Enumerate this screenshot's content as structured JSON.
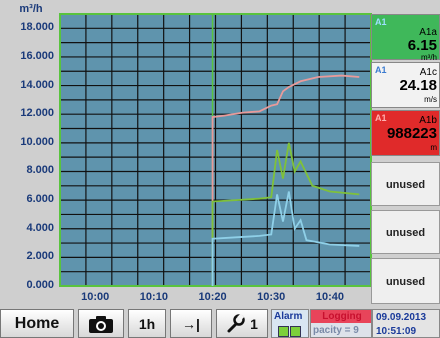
{
  "chart": {
    "unit_label": "m³/h",
    "y_ticks": [
      "18.000",
      "16.000",
      "14.000",
      "12.000",
      "10.000",
      "8.000",
      "6.000",
      "4.000",
      "2.000",
      "0.000"
    ],
    "x_ticks": [
      "10:00",
      "10:10",
      "10:20",
      "10:30",
      "10:40"
    ],
    "colors": {
      "background": "#5f94ad",
      "grid": "#111111",
      "frame": "#59c33e",
      "cursor": "#59c33e",
      "series_pink": "#e89a9a",
      "series_green": "#7fc13a",
      "series_cyan": "#8fd0e8"
    }
  },
  "chart_data": {
    "type": "line",
    "ylabel": "m³/h",
    "ylim": [
      0,
      19
    ],
    "xlim": [
      "09:54",
      "10:47"
    ],
    "grid": true,
    "cursor_x": "10:20",
    "series": [
      {
        "color": "#e89a9a",
        "points": [
          [
            "10:20",
            11.8
          ],
          [
            "10:22",
            11.9
          ],
          [
            "10:25",
            12.1
          ],
          [
            "10:28",
            12.2
          ],
          [
            "10:30",
            12.6
          ],
          [
            "10:31",
            12.7
          ],
          [
            "10:32",
            13.6
          ],
          [
            "10:33",
            13.9
          ],
          [
            "10:35",
            14.3
          ],
          [
            "10:38",
            14.6
          ],
          [
            "10:42",
            14.7
          ],
          [
            "10:45",
            14.6
          ]
        ]
      },
      {
        "color": "#7fc13a",
        "points": [
          [
            "10:20",
            5.9
          ],
          [
            "10:24",
            6.0
          ],
          [
            "10:28",
            6.1
          ],
          [
            "10:30",
            6.2
          ],
          [
            "10:31",
            9.5
          ],
          [
            "10:32",
            7.5
          ],
          [
            "10:33",
            10.0
          ],
          [
            "10:34",
            8.0
          ],
          [
            "10:35",
            8.7
          ],
          [
            "10:37",
            7.0
          ],
          [
            "10:40",
            6.6
          ],
          [
            "10:45",
            6.4
          ]
        ]
      },
      {
        "color": "#8fd0e8",
        "points": [
          [
            "10:20",
            3.3
          ],
          [
            "10:24",
            3.4
          ],
          [
            "10:28",
            3.5
          ],
          [
            "10:30",
            3.6
          ],
          [
            "10:31",
            6.4
          ],
          [
            "10:32",
            4.5
          ],
          [
            "10:33",
            6.6
          ],
          [
            "10:34",
            4.0
          ],
          [
            "10:35",
            4.6
          ],
          [
            "10:36",
            3.2
          ],
          [
            "10:40",
            2.9
          ],
          [
            "10:45",
            2.8
          ]
        ]
      }
    ]
  },
  "tiles": [
    {
      "chan": "A1",
      "name": "A1a",
      "value": "6.15",
      "unit": "m³/h",
      "bg": "#3fb85a"
    },
    {
      "chan": "A1",
      "name": "A1c",
      "value": "24.18",
      "unit": "m/s",
      "bg": "#f2f2f2"
    },
    {
      "chan": "A1",
      "name": "A1b",
      "value": "988223",
      "unit": "m",
      "bg": "#e02a2a"
    }
  ],
  "unused": [
    "unused",
    "unused",
    "unused"
  ],
  "toolbar": {
    "home_label": "Home",
    "range_label": "1h",
    "jump_label": "→|",
    "tool_count": "1",
    "alarm_label": "Alarm",
    "status_top": "Logging",
    "status_bottom": "pacity = 9",
    "date": "09.09.2013",
    "time": "10:51:09"
  }
}
